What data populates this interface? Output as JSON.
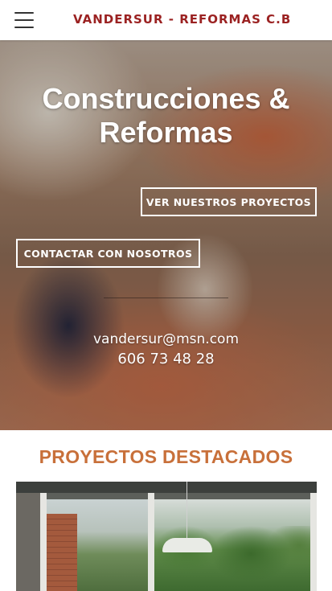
{
  "header": {
    "menu_icon": "hamburger-menu-icon",
    "site_title": "VANDERSUR - REFORMAS C.B",
    "title_color": "#9b2222"
  },
  "hero": {
    "title": "Construcciones & Reformas",
    "projects_button": "VER NUESTROS PROYECTOS",
    "contact_button": "CONTACTAR CON NOSOTROS",
    "email": "vandersur@msn.com",
    "phone": "606 73 48 28"
  },
  "featured": {
    "title": "PROYECTOS DESTACADOS",
    "title_color": "#c8703a"
  }
}
